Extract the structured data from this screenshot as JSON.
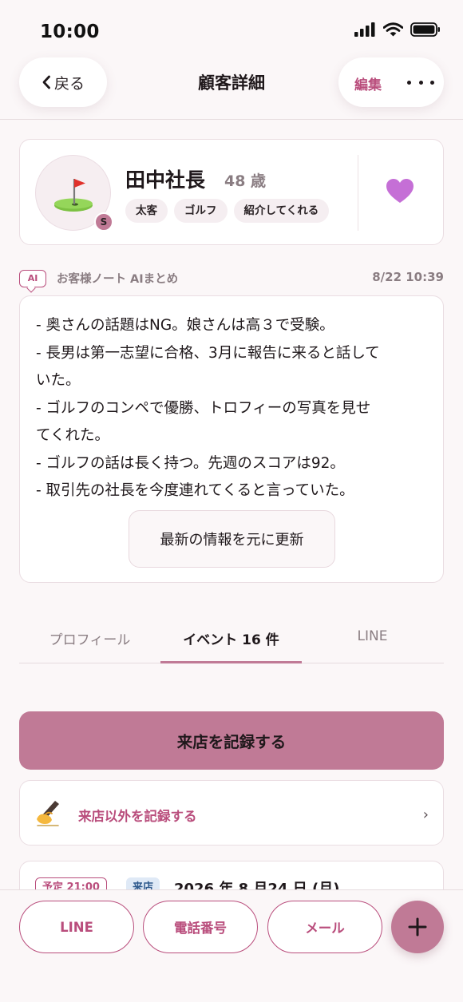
{
  "status_bar": {
    "time": "10:00"
  },
  "header": {
    "back_label": "戻る",
    "title": "顧客詳細",
    "edit_label": "編集"
  },
  "customer": {
    "name": "田中社長",
    "age": "48 歳",
    "rank_badge": "S",
    "tags": [
      "太客",
      "ゴルフ",
      "紹介してくれる"
    ],
    "favorite": true
  },
  "ai_note": {
    "badge": "AI",
    "title": "お客様ノート AIまとめ",
    "date": "8/22 10:39",
    "lines": [
      "- 奥さんの話題はNG。娘さんは高３で受験。",
      "- 長男は第一志望に合格、3月に報告に来ると話して",
      "いた。",
      "- ゴルフのコンペで優勝、トロフィーの写真を見せ",
      "てくれた。",
      "- ゴルフの話は長く持つ。先週のスコアは92。",
      "- 取引先の社長を今度連れてくると言っていた。"
    ],
    "refresh_label": "最新の情報を元に更新"
  },
  "tabs": [
    {
      "label": "プロフィール",
      "active": false
    },
    {
      "label": "イベント 16 件",
      "active": true
    },
    {
      "label": "LINE",
      "active": false
    }
  ],
  "actions": {
    "record_visit_label": "来店を記録する",
    "record_other_label": "来店以外を記録する"
  },
  "event": {
    "time_badge": "予定 21:00",
    "type_badge": "来店",
    "date": "2026 年 8 月24 日 (月)"
  },
  "bottom_bar": {
    "line_label": "LINE",
    "phone_label": "電話番号",
    "mail_label": "メール"
  },
  "colors": {
    "accent": "#b94d7c",
    "accent_fill": "#c07a96",
    "background": "#fbf7f8",
    "favorite": "#c56fd6"
  }
}
